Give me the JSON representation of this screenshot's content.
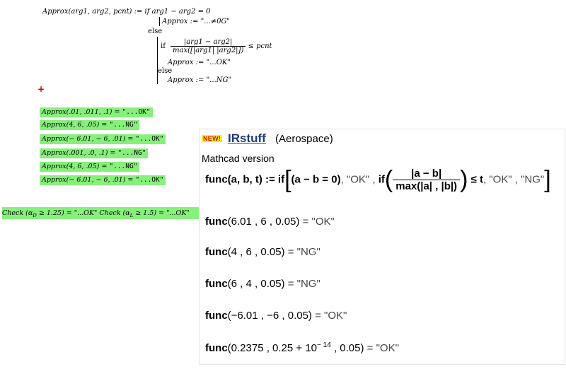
{
  "definition": {
    "header": "Approx(arg1, arg2, pcnt) := if  arg1 − arg2 = 0",
    "branch1": "Approx := \"...≠0G\"",
    "else1": "else",
    "if2_label": "if",
    "if2_num": "|arg1 − arg2|",
    "if2_den": "max([|arg1| |arg2|])",
    "if2_cmp": "≤ pcnt",
    "branch2": "Approx := \"...OK\"",
    "else2": "else",
    "branch3": "Approx := \"...NG\""
  },
  "insert_marker": "+",
  "results": [
    {
      "expr": "Approx(.01, .011, .1) = ",
      "val": "\"...OK\""
    },
    {
      "expr": "Approx(4, 6, .05) = ",
      "val": "\"...NG\""
    },
    {
      "expr": "Approx(− 6.01, − 6, .01) = ",
      "val": "\"...OK\""
    },
    {
      "expr": "Approx(.001, .0, .1) = ",
      "val": "\"...NG\""
    },
    {
      "expr": "Approx(4, 6, .05) = ",
      "val": "\"...NG\""
    },
    {
      "expr": "Approx(− 6.01, − 6, .01) = ",
      "val": "\"...OK\""
    }
  ],
  "check": {
    "c1_pre": "Check (α",
    "c1_sub": "D",
    "c1_post": " ≥ 1.25) = \"...OK\"",
    "c2_pre": " Check (α",
    "c2_sub": "L",
    "c2_post": " ≥ 1.5) = \"...OK\""
  },
  "panel": {
    "new_tag": "NEW!",
    "link": "IRstuff",
    "subtitle": "(Aerospace)",
    "version": "Mathcad version",
    "formula": {
      "lhs": "func(a, b, t) := ",
      "if1": "if",
      "cond1": "(a − b = 0)",
      "ok1": ", \"OK\" , ",
      "if2": "if",
      "num": "|a − b|",
      "den": "max(|a| , |b|)",
      "cmp": " ≤ t",
      "tail": ", \"OK\" , \"NG\""
    },
    "results": [
      {
        "call": "func",
        "args": "(6.01 , 6 , 0.05)",
        "val": " = \"OK\""
      },
      {
        "call": "func",
        "args": "(4 , 6 , 0.05)",
        "val": " = \"NG\""
      },
      {
        "call": "func",
        "args": "(6 , 4 , 0.05)",
        "val": " = \"NG\""
      },
      {
        "call": "func",
        "args": "(−6.01 , −6 , 0.05)",
        "val": " = \"OK\""
      }
    ],
    "last": {
      "call": "func",
      "pre": "(0.2375 , 0.25 + 10",
      "exp": "− 14",
      "post": " , 0.05)",
      "val": " = \"OK\""
    }
  }
}
